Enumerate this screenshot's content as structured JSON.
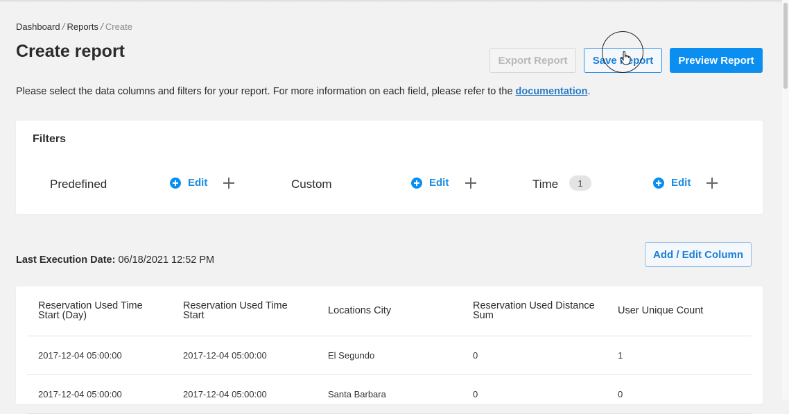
{
  "breadcrumb": {
    "items": [
      "Dashboard",
      "Reports"
    ],
    "current": "Create",
    "separator": "/"
  },
  "page": {
    "title": "Create report",
    "intro_text": "Please select the data columns and filters for your report. For more information on each field, please refer to the ",
    "intro_link": "documentation",
    "intro_end": "."
  },
  "actions": {
    "export_label": "Export Report",
    "save_label": "Save Report",
    "preview_label": "Preview Report"
  },
  "filters": {
    "title": "Filters",
    "groups": [
      {
        "name": "Predefined",
        "edit_label": "Edit"
      },
      {
        "name": "Custom",
        "edit_label": "Edit"
      },
      {
        "name": "Time",
        "edit_label": "Edit",
        "count": "1"
      }
    ]
  },
  "execution": {
    "label": "Last Execution Date:",
    "value": "06/18/2021 12:52 PM"
  },
  "columns_button": "Add / Edit Column",
  "table": {
    "headers": [
      "Reservation Used Time Start (Day)",
      "Reservation Used Time Start",
      "Locations City",
      "Reservation Used Distance Sum",
      "User Unique Count"
    ],
    "rows": [
      [
        "2017-12-04 05:00:00",
        "2017-12-04 05:00:00",
        "El Segundo",
        "0",
        "1"
      ],
      [
        "2017-12-04 05:00:00",
        "2017-12-04 05:00:00",
        "Santa Barbara",
        "0",
        "0"
      ]
    ]
  },
  "colors": {
    "primary": "#0a8ef0",
    "link": "#2b7bc4",
    "background": "#f2f2f2"
  },
  "icons": [
    "plus-circle-icon",
    "add-icon",
    "hand-cursor-icon"
  ]
}
